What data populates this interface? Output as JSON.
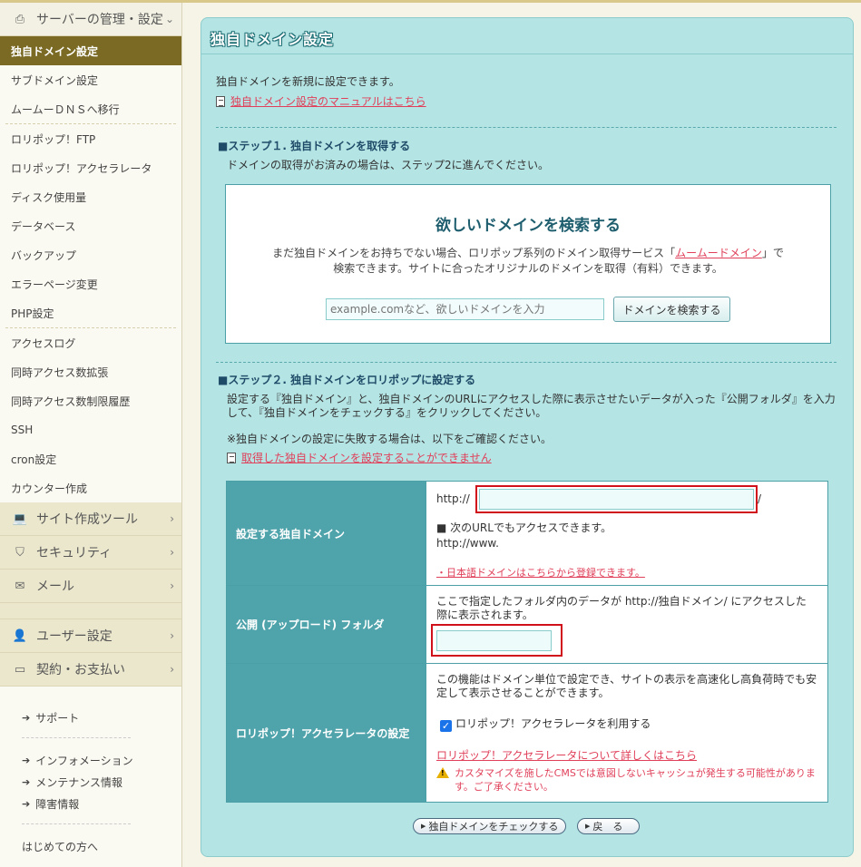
{
  "sidebar": {
    "server_section": "サーバーの管理・設定",
    "server_items": [
      {
        "label": "独自ドメイン設定",
        "active": true
      },
      {
        "label": "サブドメイン設定"
      },
      {
        "label": "ムームーＤＮＳへ移行"
      },
      {
        "label": "ロリポップ！FTP"
      },
      {
        "label": "ロリポップ！アクセラレータ"
      },
      {
        "label": "ディスク使用量"
      },
      {
        "label": "データベース"
      },
      {
        "label": "バックアップ"
      },
      {
        "label": "エラーページ変更"
      },
      {
        "label": "PHP設定"
      },
      {
        "label": "アクセスログ"
      },
      {
        "label": "同時アクセス数拡張"
      },
      {
        "label": "同時アクセス数制限履歴"
      },
      {
        "label": "SSH"
      },
      {
        "label": "cron設定"
      },
      {
        "label": "カウンター作成"
      }
    ],
    "categories": [
      {
        "label": "サイト作成ツール",
        "icon": "laptop-icon"
      },
      {
        "label": "セキュリティ",
        "icon": "shield-icon"
      },
      {
        "label": "メール",
        "icon": "mail-icon"
      },
      {
        "label": "ユーザー設定",
        "icon": "user-icon"
      },
      {
        "label": "契約・お支払い",
        "icon": "card-icon"
      }
    ],
    "links": {
      "support": "サポート",
      "information": "インフォメーション",
      "maintenance": "メンテナンス情報",
      "trouble": "障害情報",
      "beginner": "はじめての方へ"
    }
  },
  "main": {
    "title": "独自ドメイン設定",
    "intro": "独自ドメインを新規に設定できます。",
    "manual_link": "独自ドメイン設定のマニュアルはこちら",
    "step1": {
      "heading": "■ステップ１. 独自ドメインを取得する",
      "desc": "ドメインの取得がお済みの場合は、ステップ2に進んでください。",
      "search_title": "欲しいドメインを検索する",
      "search_desc_pre": "まだ独自ドメインをお持ちでない場合、ロリポップ系列のドメイン取得サービス「",
      "search_desc_link": "ムームードメイン",
      "search_desc_post": "」で",
      "search_desc_line2": "検索できます。サイトに合ったオリジナルのドメインを取得（有料）できます。",
      "search_placeholder": "example.comなど、欲しいドメインを入力",
      "search_button": "ドメインを検索する"
    },
    "step2": {
      "heading": "■ステップ２. 独自ドメインをロリポップに設定する",
      "desc_line1": "設定する『独自ドメイン』と、独自ドメインのURLにアクセスした際に表示させたいデータが入った『公開フォルダ』を入力",
      "desc_line2": "して、『独自ドメインをチェックする』をクリックしてください。",
      "note": "※独自ドメインの設定に失敗する場合は、以下をご確認ください。",
      "fail_link": "取得した独自ドメインを設定することができません"
    },
    "form": {
      "domain_label": "設定する独自ドメイン",
      "http_prefix": "http://",
      "slash": "/",
      "alt_note": "■ 次のURLでもアクセスできます。",
      "alt_url": "http://www.",
      "jp_domain_link": "・日本語ドメインはこちらから登録できます。",
      "folder_label": "公開 (アップロード) フォルダ",
      "folder_desc_line1": "ここで指定したフォルダ内のデータが http://独自ドメイン/ にアクセスした",
      "folder_desc_line2": "際に表示されます。",
      "accel_label": "ロリポップ！アクセラレータの設定",
      "accel_desc_line1": "この機能はドメイン単位で設定でき、サイトの表示を高速化し高負荷時でも安",
      "accel_desc_line2": "定して表示させることができます。",
      "accel_checkbox": "ロリポップ！アクセラレータを利用する",
      "accel_link": "ロリポップ！アクセラレータについて詳しくはこちら",
      "accel_warn_line1": "カスタマイズを施したCMSでは意図しないキャッシュが発生する可能性がありま",
      "accel_warn_line2": "す。ご了承ください。"
    },
    "buttons": {
      "check": "独自ドメインをチェックする",
      "back": "戻　る"
    }
  }
}
